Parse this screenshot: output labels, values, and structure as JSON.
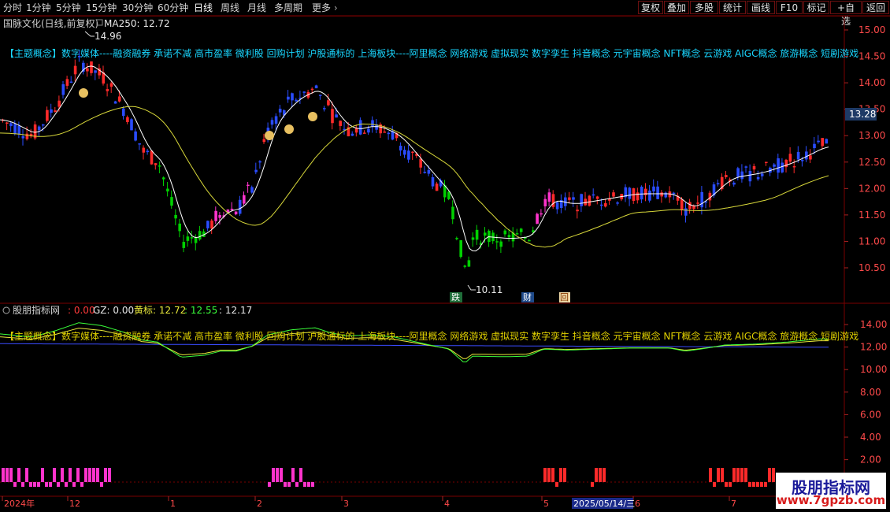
{
  "toolbar": {
    "tabs": [
      "分时",
      "1分钟",
      "5分钟",
      "15分钟",
      "30分钟",
      "60分钟",
      "日线",
      "周线",
      "月线",
      "多周期"
    ],
    "more": "更多",
    "active": "日线",
    "right_buttons": [
      "复权",
      "叠加",
      "多股",
      "统计",
      "画线",
      "F10",
      "标记",
      "+自选",
      "返回"
    ]
  },
  "main_panel": {
    "stock_title": "国脉文化(日线,前复权)",
    "ma_label": "MA250: 12.72",
    "concepts": "【主题概念】数字媒体----融资融券 承诺不减 高市盈率 微利股 回购计划 沪股通标的 上海板块----阿里概念 网络游戏 虚拟现实 数字孪生 抖音概念 元宇宙概念 NFT概念 云游戏 AIGC概念 旅游概念 短剧游戏",
    "y_ticks": [
      "15.00",
      "14.50",
      "14.00",
      "13.50",
      "13.00",
      "12.50",
      "12.00",
      "11.50",
      "11.00",
      "10.50"
    ],
    "current_price": "13.28",
    "high_label": "14.96",
    "low_label": "10.11",
    "markers": [
      "跌",
      "财",
      "回"
    ]
  },
  "sub_panel": {
    "title": "股朋指标网",
    "v1": ": 0.00",
    "gz": "GZ: 0.00",
    "hb": "黄标: 12.72",
    "v2": ": 12.55",
    "v3": ": 12.17",
    "y_ticks": [
      "14.00",
      "12.00",
      "10.00",
      "8.00",
      "6.00",
      "4.00",
      "2.00"
    ]
  },
  "date_axis": {
    "labels": [
      "2024年",
      "12",
      "1",
      "2",
      "3",
      "4",
      "5",
      "6",
      "7"
    ],
    "cursor_date": "2025/05/14/三"
  },
  "watermark": {
    "line1": "股朋指标网",
    "line2": "www.7gpzb.com"
  },
  "colors": {
    "up": "#ff2a2a",
    "down": "#2a4cff",
    "flat": "#00d000",
    "pink": "#ff33cc",
    "ma_white": "#ffffff",
    "ma_yellow": "#d8d83a",
    "concept": "#19d6ff",
    "sub_concept": "#e0d000",
    "border": "#7a0000"
  }
}
